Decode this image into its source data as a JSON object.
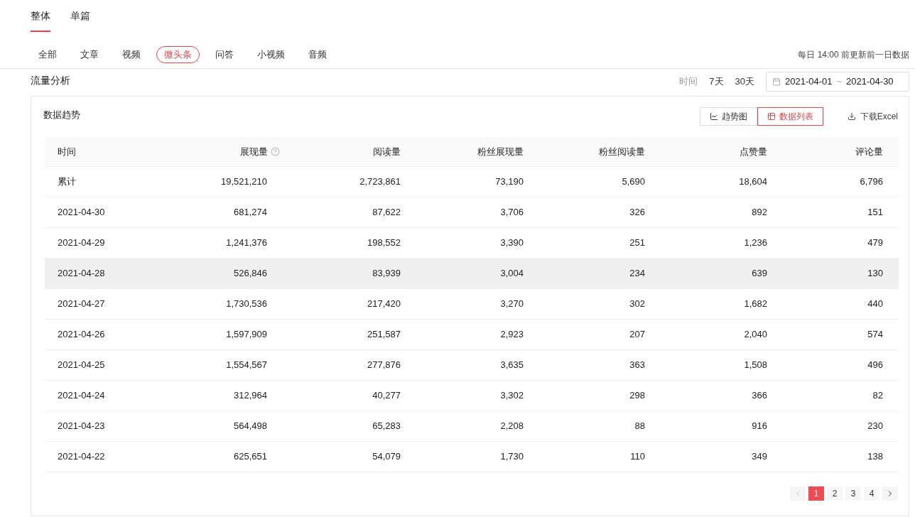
{
  "scope_tabs": [
    {
      "label": "整体",
      "selected": true
    },
    {
      "label": "单篇",
      "selected": false
    }
  ],
  "content_tabs": [
    {
      "label": "全部",
      "selected": false
    },
    {
      "label": "文章",
      "selected": false
    },
    {
      "label": "视频",
      "selected": false
    },
    {
      "label": "微头条",
      "selected": true
    },
    {
      "label": "问答",
      "selected": false
    },
    {
      "label": "小视频",
      "selected": false
    },
    {
      "label": "音频",
      "selected": false
    }
  ],
  "update_note": "每日 14:00 前更新前一日数据",
  "section_title": "流量分析",
  "time_filter": {
    "label": "时间",
    "options": [
      {
        "label": "7天",
        "selected": false
      },
      {
        "label": "30天",
        "selected": false
      }
    ],
    "start": "2021-04-01",
    "separator": "~",
    "end": "2021-04-30"
  },
  "card": {
    "title": "数据趋势",
    "view_toggle": [
      {
        "label": "趋势图",
        "kind": "chart",
        "selected": false
      },
      {
        "label": "数据列表",
        "kind": "table",
        "selected": true
      }
    ],
    "download": "下载Excel",
    "table": {
      "columns": [
        {
          "label": "时间",
          "help": false
        },
        {
          "label": "展现量",
          "help": true
        },
        {
          "label": "阅读量",
          "help": false
        },
        {
          "label": "粉丝展现量",
          "help": false
        },
        {
          "label": "粉丝阅读量",
          "help": false
        },
        {
          "label": "点赞量",
          "help": false
        },
        {
          "label": "评论量",
          "help": false
        }
      ],
      "rows": [
        {
          "highlighted": false,
          "cells": [
            "累计",
            "19,521,210",
            "2,723,861",
            "73,190",
            "5,690",
            "18,604",
            "6,796"
          ]
        },
        {
          "highlighted": false,
          "cells": [
            "2021-04-30",
            "681,274",
            "87,622",
            "3,706",
            "326",
            "892",
            "151"
          ]
        },
        {
          "highlighted": false,
          "cells": [
            "2021-04-29",
            "1,241,376",
            "198,552",
            "3,390",
            "251",
            "1,236",
            "479"
          ]
        },
        {
          "highlighted": true,
          "cells": [
            "2021-04-28",
            "526,846",
            "83,939",
            "3,004",
            "234",
            "639",
            "130"
          ]
        },
        {
          "highlighted": false,
          "cells": [
            "2021-04-27",
            "1,730,536",
            "217,420",
            "3,270",
            "302",
            "1,682",
            "440"
          ]
        },
        {
          "highlighted": false,
          "cells": [
            "2021-04-26",
            "1,597,909",
            "251,587",
            "2,923",
            "207",
            "2,040",
            "574"
          ]
        },
        {
          "highlighted": false,
          "cells": [
            "2021-04-25",
            "1,554,567",
            "277,876",
            "3,635",
            "363",
            "1,508",
            "496"
          ]
        },
        {
          "highlighted": false,
          "cells": [
            "2021-04-24",
            "312,964",
            "40,277",
            "3,302",
            "298",
            "366",
            "82"
          ]
        },
        {
          "highlighted": false,
          "cells": [
            "2021-04-23",
            "564,498",
            "65,283",
            "2,208",
            "88",
            "916",
            "230"
          ]
        },
        {
          "highlighted": false,
          "cells": [
            "2021-04-22",
            "625,651",
            "54,079",
            "1,730",
            "110",
            "349",
            "138"
          ]
        }
      ]
    },
    "pagination": {
      "prev_disabled": true,
      "pages": [
        {
          "label": "1",
          "selected": true
        },
        {
          "label": "2",
          "selected": false
        },
        {
          "label": "3",
          "selected": false
        },
        {
          "label": "4",
          "selected": false
        }
      ],
      "next_disabled": false
    }
  }
}
